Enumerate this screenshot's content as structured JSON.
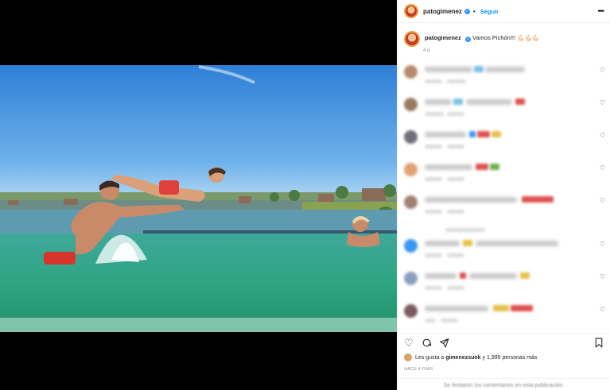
{
  "post": {
    "username": "patogimenez",
    "follow_label": "Seguir",
    "caption_text": "Vamos Pichón!!! 💪🏻💪🏻💪🏻",
    "age": "4 d",
    "likes_prefix": "Les gusta a ",
    "likes_user": "gimenezsuok",
    "likes_suffix": " y 1,995 personas más",
    "timestamp": "HACE 4 DÍAS",
    "limited_comments": "Se limitaron los comentarios en esta publicación."
  },
  "colors": {
    "accent": "#0095f6",
    "verified": "#3897f0"
  },
  "icons": {
    "like": "heart-icon",
    "comment": "comment-icon",
    "share": "share-icon",
    "save": "bookmark-icon",
    "more": "more-options-icon"
  }
}
